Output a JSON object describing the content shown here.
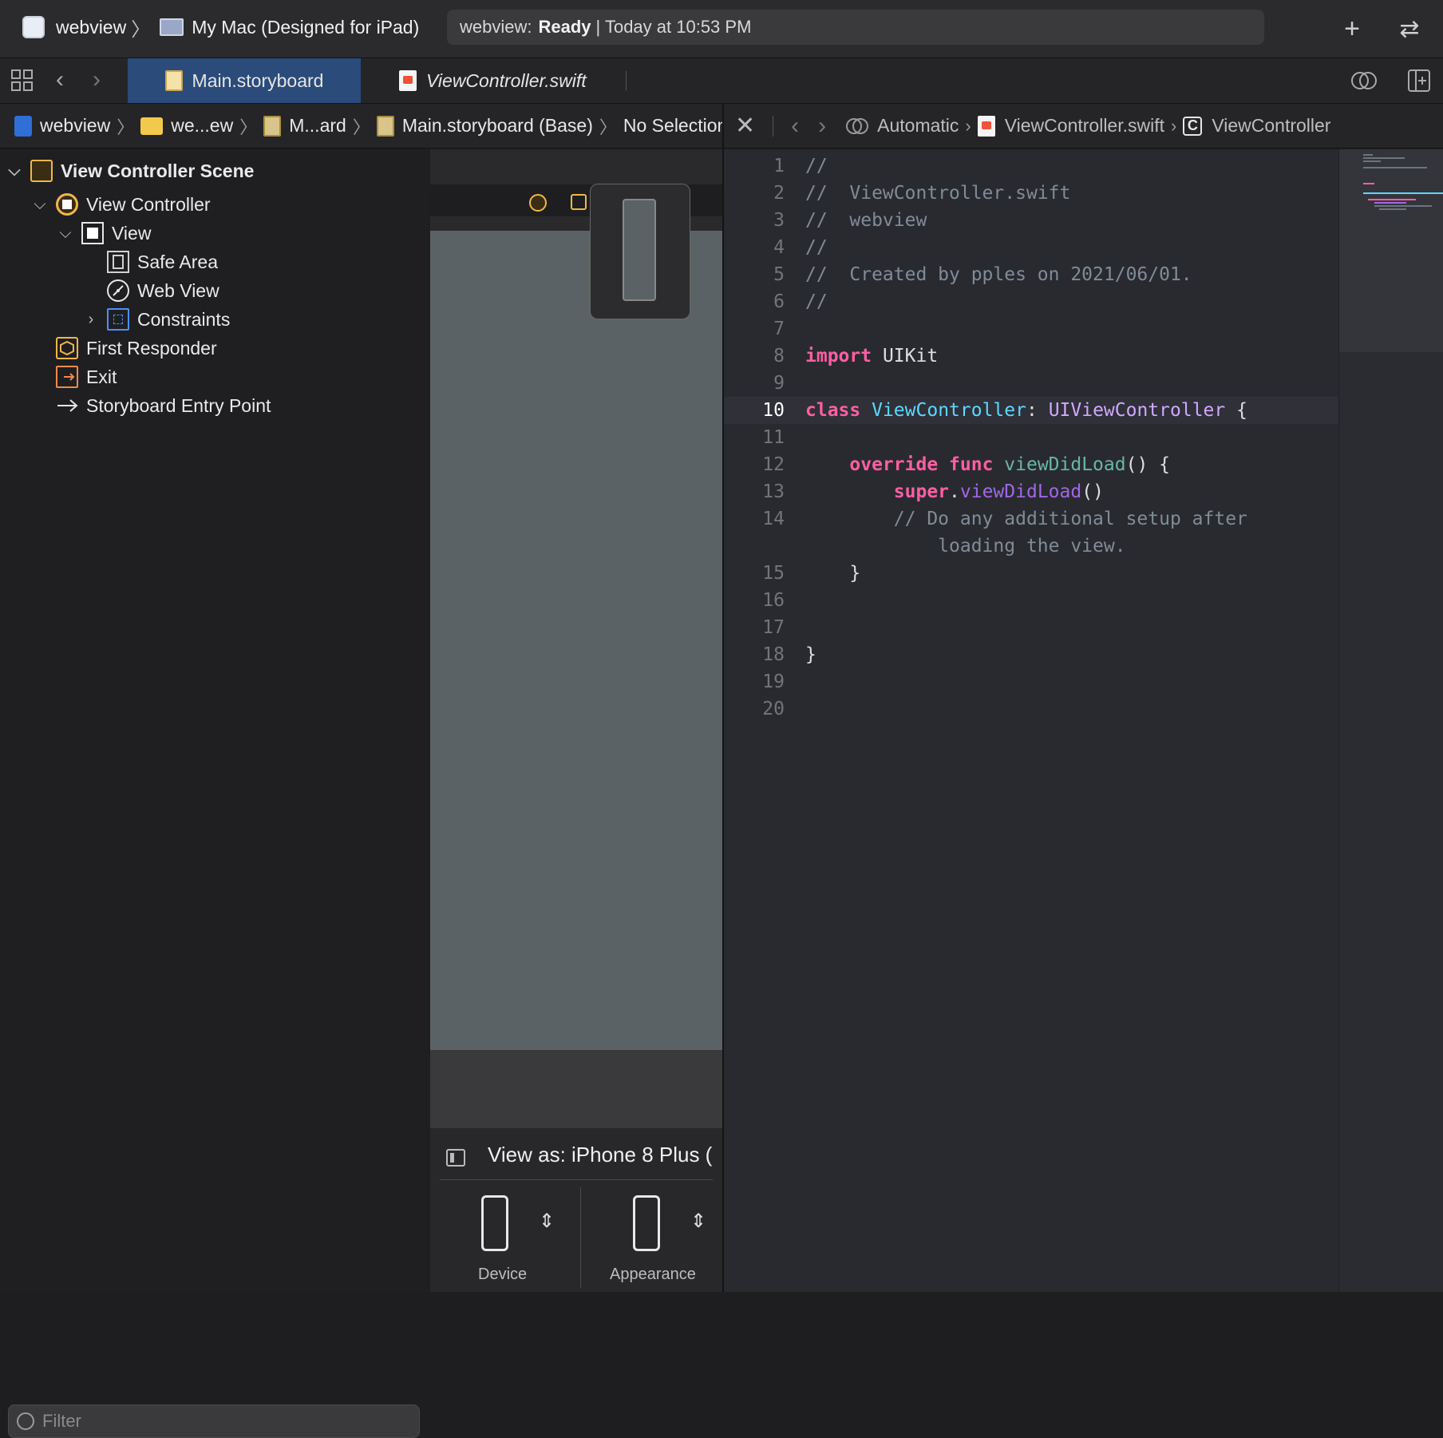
{
  "toolbar": {
    "scheme": "webview",
    "destination": "My Mac (Designed for iPad)",
    "activity_prefix": "webview:",
    "activity_status": "Ready",
    "activity_time": "| Today at 10:53 PM",
    "add_icon": "plus-icon",
    "swap_icon": "arrow-swap-icon"
  },
  "tabs": [
    {
      "label": "Main.storyboard",
      "active": true
    },
    {
      "label": "ViewController.swift",
      "active": false
    }
  ],
  "left_jumpbar": [
    "webview",
    "we...ew",
    "M...ard",
    "Main.storyboard (Base)",
    "No Selection"
  ],
  "right_jumpbar": [
    "Automatic",
    "ViewController.swift",
    "ViewController"
  ],
  "outline": {
    "items": [
      {
        "label": "View Controller Scene",
        "icon": "scene-icon"
      },
      {
        "label": "View Controller",
        "icon": "view-controller-icon"
      },
      {
        "label": "View",
        "icon": "view-icon"
      },
      {
        "label": "Safe Area",
        "icon": "safe-area-icon"
      },
      {
        "label": "Web View",
        "icon": "web-view-icon"
      },
      {
        "label": "Constraints",
        "icon": "constraints-icon"
      },
      {
        "label": "First Responder",
        "icon": "first-responder-icon"
      },
      {
        "label": "Exit",
        "icon": "exit-icon"
      },
      {
        "label": "Storyboard Entry Point",
        "icon": "entry-arrow-icon"
      }
    ],
    "filter_placeholder": "Filter"
  },
  "canvas": {
    "view_as": "View as: iPhone 8 Plus (",
    "device_label": "Device",
    "appearance_label": "Appearance"
  },
  "editor": {
    "current_line": 10,
    "line_numbers": [
      "1",
      "2",
      "3",
      "4",
      "5",
      "6",
      "7",
      "8",
      "9",
      "10",
      "11",
      "12",
      "13",
      "14",
      "",
      "15",
      "16",
      "17",
      "18",
      "19",
      "20"
    ],
    "lines": [
      "//",
      "//  ViewController.swift",
      "//  webview",
      "//",
      "//  Created by pples on 2021/06/01.",
      "//",
      "",
      "import UIKit",
      "",
      "class ViewController: UIViewController {",
      "",
      "    override func viewDidLoad() {",
      "        super.viewDidLoad()",
      "        // Do any additional setup after",
      "            loading the view.",
      "    }",
      "",
      "",
      "}",
      "",
      ""
    ]
  },
  "colors": {
    "keyword": "#fc5fa3",
    "type": "#5dd8ff",
    "comment": "#7f8c98",
    "active_tab": "#2b4b7a"
  }
}
